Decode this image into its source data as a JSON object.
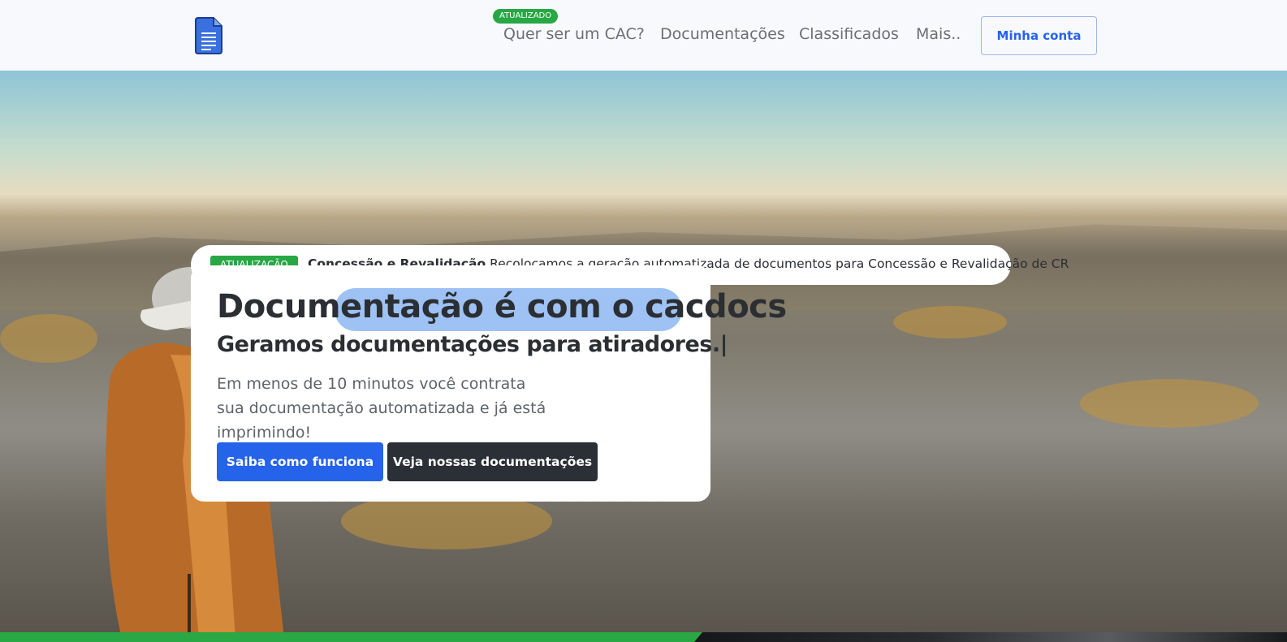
{
  "nav": {
    "badge": "ATUALIZADO",
    "links": [
      "Quer ser um CAC?",
      "Documentações",
      "Classificados",
      "Mais.."
    ],
    "account_button": "Minha conta"
  },
  "announcement": {
    "badge": "ATUALIZAÇÃO",
    "title": "Concessão e Revalidação",
    "text": "Recolocamos a geração automatizada de documentos para Concessão e Revalidação de CR"
  },
  "hero": {
    "title_prefix": "Documentação é com o ",
    "title_brand": "cacdocs",
    "subtitle": "Geramos documentações para atiradores.|",
    "description": "Em menos de 10 minutos você contrata sua documentação automatizada e já está imprimindo!",
    "primary_button": "Saiba como funciona",
    "secondary_button": "Veja nossas documentações"
  },
  "colors": {
    "primary": "#2563eb",
    "success": "#28a745",
    "dark": "#2b2f36",
    "highlight": "#9fc2f4"
  },
  "icons": {
    "logo": "document-icon"
  }
}
